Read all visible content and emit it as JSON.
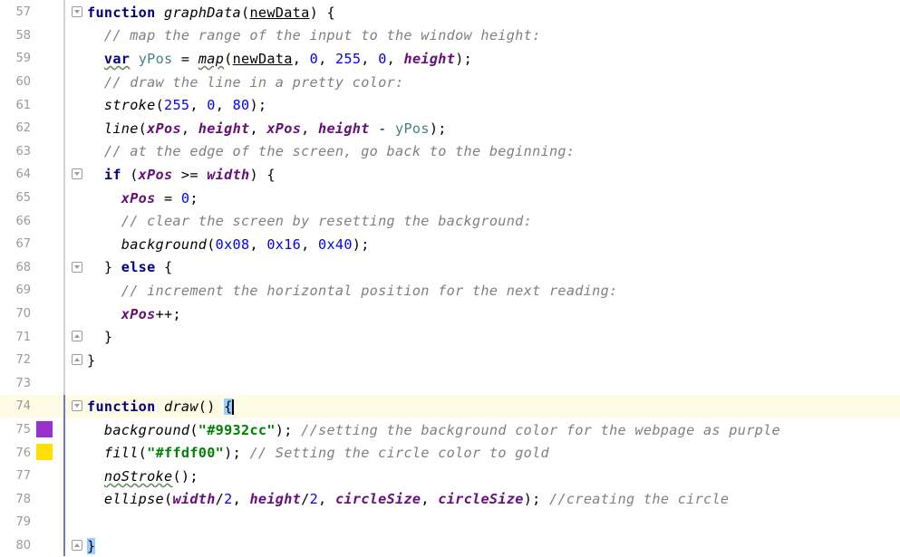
{
  "editor": {
    "current_line": 74,
    "lines": [
      {
        "num": "57",
        "t": [
          "function ",
          "graphData",
          "(",
          "newData",
          ") {"
        ]
      },
      {
        "num": "58",
        "t": [
          "  // map the range of the input to the window height:"
        ]
      },
      {
        "num": "59",
        "t": [
          "  ",
          "var",
          " ",
          "yPos",
          " = ",
          "map",
          "(",
          "newData",
          ", ",
          "0",
          ", ",
          "255",
          ", ",
          "0",
          ", ",
          "height",
          ");"
        ]
      },
      {
        "num": "60",
        "t": [
          "  // draw the line in a pretty color:"
        ]
      },
      {
        "num": "61",
        "t": [
          "  ",
          "stroke",
          "(",
          "255",
          ", ",
          "0",
          ", ",
          "80",
          ");"
        ]
      },
      {
        "num": "62",
        "t": [
          "  ",
          "line",
          "(",
          "xPos",
          ", ",
          "height",
          ", ",
          "xPos",
          ", ",
          "height",
          " - ",
          "yPos",
          ");"
        ]
      },
      {
        "num": "63",
        "t": [
          "  // at the edge of the screen, go back to the beginning:"
        ]
      },
      {
        "num": "64",
        "t": [
          "  ",
          "if",
          " (",
          "xPos",
          " >= ",
          "width",
          ") {"
        ]
      },
      {
        "num": "65",
        "t": [
          "    ",
          "xPos",
          " = ",
          "0",
          ";"
        ]
      },
      {
        "num": "66",
        "t": [
          "    // clear the screen by resetting the background:"
        ]
      },
      {
        "num": "67",
        "t": [
          "    ",
          "background",
          "(",
          "0x08",
          ", ",
          "0x16",
          ", ",
          "0x40",
          ");"
        ]
      },
      {
        "num": "68",
        "t": [
          "  } ",
          "else",
          " {"
        ]
      },
      {
        "num": "69",
        "t": [
          "    // increment the horizontal position for the next reading:"
        ]
      },
      {
        "num": "70",
        "t": [
          "    ",
          "xPos",
          "++;"
        ]
      },
      {
        "num": "71",
        "t": [
          "  }"
        ]
      },
      {
        "num": "72",
        "t": [
          "}"
        ]
      },
      {
        "num": "73",
        "t": [
          ""
        ]
      },
      {
        "num": "74",
        "t": [
          "function ",
          "draw",
          "() ",
          "{"
        ]
      },
      {
        "num": "75",
        "t": [
          "  ",
          "background",
          "(",
          "\"#9932cc\"",
          "); ",
          "//setting the background color for the webpage as purple"
        ]
      },
      {
        "num": "76",
        "t": [
          "  ",
          "fill",
          "(",
          "\"#ffdf00\"",
          "); ",
          "// Setting the circle color to gold"
        ]
      },
      {
        "num": "77",
        "t": [
          "  ",
          "noStroke",
          "();"
        ]
      },
      {
        "num": "78",
        "t": [
          "  ",
          "ellipse",
          "(",
          "width",
          "/",
          "2",
          ", ",
          "height",
          "/",
          "2",
          ", ",
          "circleSize",
          ", ",
          "circleSize",
          "); ",
          "//creating the circle"
        ]
      },
      {
        "num": "79",
        "t": [
          ""
        ]
      },
      {
        "num": "80",
        "t": [
          "}"
        ]
      }
    ],
    "color_swatches": {
      "75": "#9932cc",
      "76": "#ffdf00"
    },
    "fold_markers": {
      "57": "open",
      "64": "open",
      "68": "open",
      "71": "close",
      "72": "close",
      "74": "open",
      "80": "close"
    }
  }
}
